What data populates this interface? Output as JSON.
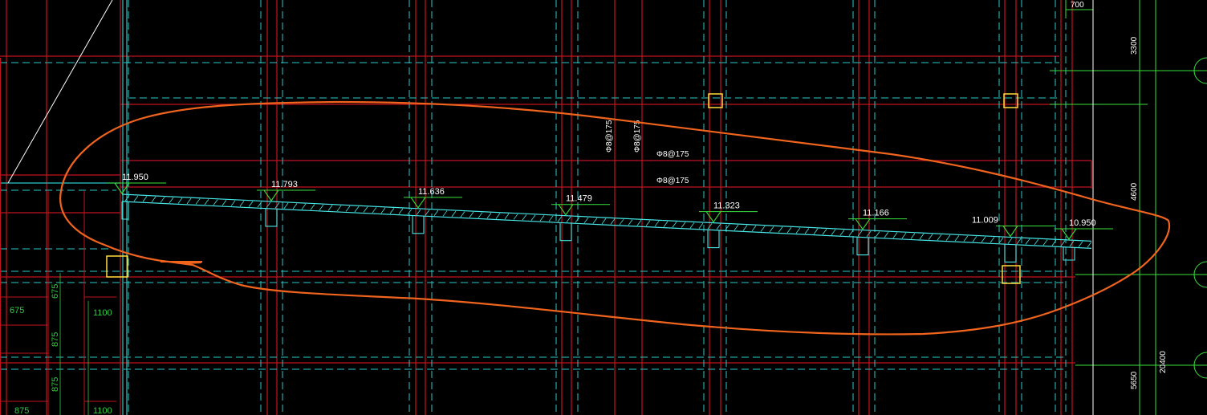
{
  "drawing": {
    "background": "#000000",
    "colors": {
      "axis_red": "#c0141e",
      "wall_cyan": "#2fc6c6",
      "slab_cyan": "#46e6e6",
      "level_green": "#38e03c",
      "column_yellow": "#ffdc3c",
      "markup_orange": "#f0641e",
      "dim_green": "#2ecc40",
      "text_white": "#ffffff"
    },
    "elevations": [
      {
        "label": "11.950",
        "station": 0
      },
      {
        "label": "11.793",
        "station": 1
      },
      {
        "label": "11.636",
        "station": 2
      },
      {
        "label": "11.479",
        "station": 3
      },
      {
        "label": "11.323",
        "station": 4
      },
      {
        "label": "11.166",
        "station": 5
      },
      {
        "label": "11.009",
        "station": 6
      },
      {
        "label": "10.950",
        "station": 7
      }
    ],
    "rebar_labels": {
      "vertical_1": "Φ8@175",
      "vertical_2": "Φ8@175",
      "horizontal_top": "Φ8@175",
      "horizontal_bottom": "Φ8@175"
    },
    "dimensions": {
      "top_small": "700",
      "right_3300": "3300",
      "right_4600": "4600",
      "right_5650": "5650",
      "right_20400": "20400",
      "left_675a": "675",
      "left_675b": "675",
      "left_875a": "875",
      "left_875b": "875",
      "left_875c": "875",
      "left_1100a": "1100",
      "left_1100b": "1100"
    },
    "markup": {
      "shape": "cloud-circle",
      "color": "#f0641e"
    }
  }
}
